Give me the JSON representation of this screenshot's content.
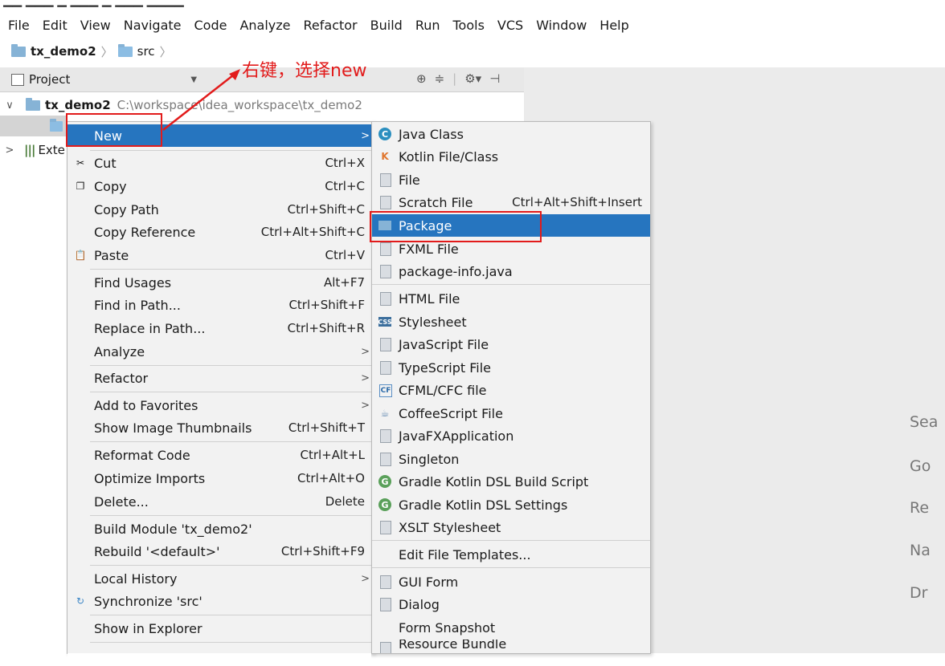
{
  "menubar": {
    "items": [
      "File",
      "Edit",
      "View",
      "Navigate",
      "Code",
      "Analyze",
      "Refactor",
      "Build",
      "Run",
      "Tools",
      "VCS",
      "Window",
      "Help"
    ]
  },
  "navbar": {
    "project": "tx_demo2",
    "folder": "src"
  },
  "project_panel": {
    "title": "Project",
    "root_name": "tx_demo2",
    "root_path": "C:\\workspace\\idea_workspace\\tx_demo2",
    "ext_label": "Exte"
  },
  "annotation": {
    "text": "右键，选择new"
  },
  "context_menu": {
    "new_label": "New",
    "items": [
      {
        "label": "Cut",
        "shortcut": "Ctrl+X",
        "icon": "scissors-icon"
      },
      {
        "label": "Copy",
        "shortcut": "Ctrl+C",
        "icon": "copy-icon"
      },
      {
        "label": "Copy Path",
        "shortcut": "Ctrl+Shift+C"
      },
      {
        "label": "Copy Reference",
        "shortcut": "Ctrl+Alt+Shift+C"
      },
      {
        "label": "Paste",
        "shortcut": "Ctrl+V",
        "icon": "paste-icon"
      },
      {
        "label": "Find Usages",
        "shortcut": "Alt+F7"
      },
      {
        "label": "Find in Path...",
        "shortcut": "Ctrl+Shift+F"
      },
      {
        "label": "Replace in Path...",
        "shortcut": "Ctrl+Shift+R"
      },
      {
        "label": "Analyze"
      },
      {
        "label": "Refactor"
      },
      {
        "label": "Add to Favorites"
      },
      {
        "label": "Show Image Thumbnails",
        "shortcut": "Ctrl+Shift+T"
      },
      {
        "label": "Reformat Code",
        "shortcut": "Ctrl+Alt+L"
      },
      {
        "label": "Optimize Imports",
        "shortcut": "Ctrl+Alt+O"
      },
      {
        "label": "Delete...",
        "shortcut": "Delete"
      },
      {
        "label": "Build Module 'tx_demo2'"
      },
      {
        "label": "Rebuild '<default>'",
        "shortcut": "Ctrl+Shift+F9"
      },
      {
        "label": "Local History"
      },
      {
        "label": "Synchronize 'src'",
        "icon": "sync-icon"
      },
      {
        "label": "Show in Explorer"
      }
    ]
  },
  "new_submenu": {
    "items": [
      {
        "label": "Java Class",
        "icon": "java-class-icon"
      },
      {
        "label": "Kotlin File/Class",
        "icon": "kotlin-icon"
      },
      {
        "label": "File",
        "icon": "file-icon"
      },
      {
        "label": "Scratch File",
        "shortcut": "Ctrl+Alt+Shift+Insert",
        "icon": "scratch-file-icon"
      },
      {
        "label": "Package",
        "icon": "package-icon"
      },
      {
        "label": "FXML File",
        "icon": "fxml-icon"
      },
      {
        "label": "package-info.java",
        "icon": "java-file-icon"
      },
      {
        "label": "HTML File",
        "icon": "html-icon"
      },
      {
        "label": "Stylesheet",
        "icon": "css-icon"
      },
      {
        "label": "JavaScript File",
        "icon": "javascript-icon"
      },
      {
        "label": "TypeScript File",
        "icon": "typescript-icon"
      },
      {
        "label": "CFML/CFC file",
        "icon": "cfml-icon"
      },
      {
        "label": "CoffeeScript File",
        "icon": "coffeescript-icon"
      },
      {
        "label": "JavaFXApplication",
        "icon": "javafx-icon"
      },
      {
        "label": "Singleton",
        "icon": "singleton-icon"
      },
      {
        "label": "Gradle Kotlin DSL Build Script",
        "icon": "gradle-icon"
      },
      {
        "label": "Gradle Kotlin DSL Settings",
        "icon": "gradle-icon"
      },
      {
        "label": "XSLT Stylesheet",
        "icon": "xslt-icon"
      },
      {
        "label": "Edit File Templates..."
      },
      {
        "label": "GUI Form",
        "icon": "gui-form-icon"
      },
      {
        "label": "Dialog",
        "icon": "dialog-icon"
      },
      {
        "label": "Form Snapshot"
      },
      {
        "label": "Resource Bundle",
        "icon": "resource-bundle-icon"
      }
    ]
  },
  "editor_hints": [
    "Sea",
    "Go",
    "Re",
    "Na",
    "Dr"
  ]
}
